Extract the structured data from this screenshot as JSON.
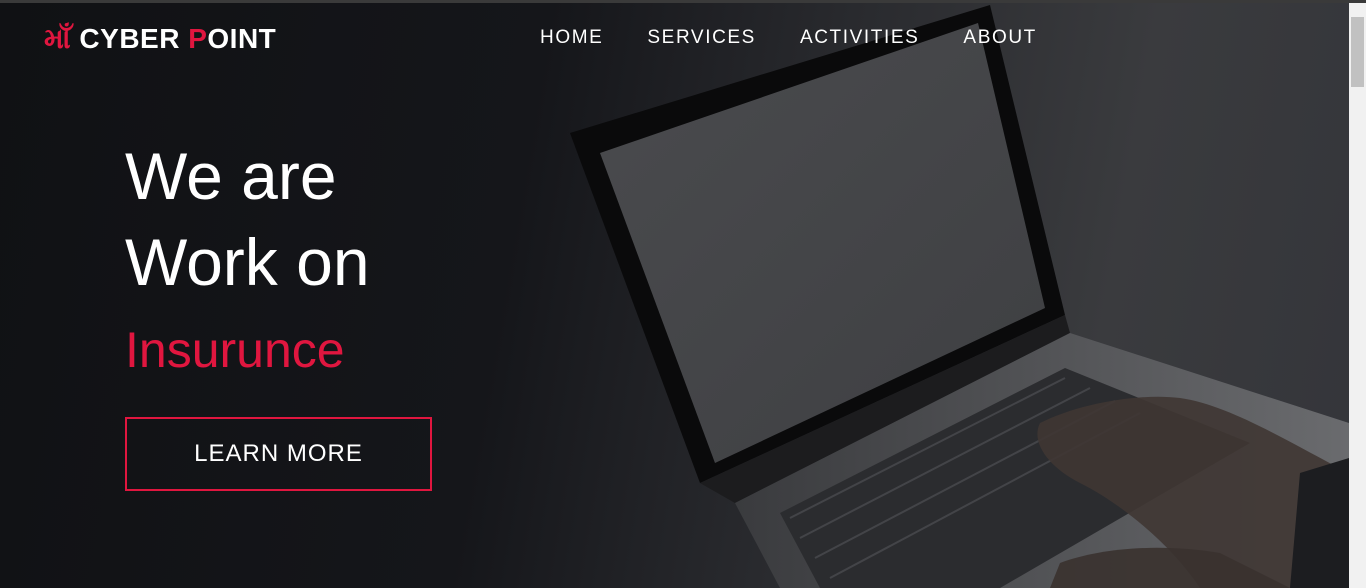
{
  "brand": {
    "mark": "માઁ",
    "name_part1": "CYBER ",
    "name_p": "P",
    "name_part2": "OINT"
  },
  "nav": {
    "items": [
      {
        "label": "HOME"
      },
      {
        "label": "SERVICES"
      },
      {
        "label": "ACTIVITIES"
      },
      {
        "label": "ABOUT"
      }
    ]
  },
  "hero": {
    "headline_line1": "We are",
    "headline_line2": "Work on",
    "subline": "Insurunce",
    "cta_label": "LEARN MORE"
  },
  "colors": {
    "accent": "#e0163f",
    "background": "#15161a",
    "text": "#ffffff"
  }
}
